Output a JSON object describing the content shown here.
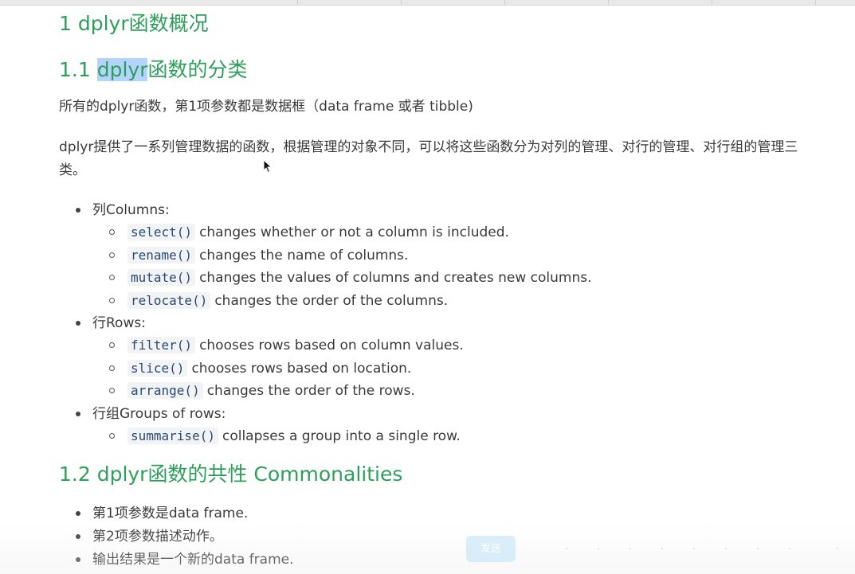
{
  "headings": {
    "h1": "1 dplyr函数概况",
    "h1_1_prefix": "1.1 ",
    "h1_1_highlight": "dplyr",
    "h1_1_suffix": "函数的分类",
    "h1_2": "1.2 dplyr函数的共性 Commonalities"
  },
  "paragraphs": {
    "p1": "所有的dplyr函数，第1项参数都是数据框（data frame 或者 tibble)",
    "p2": "dplyr提供了一系列管理数据的函数，根据管理的对象不同，可以将这些函数分为对列的管理、对行的管理、对行组的管理三类。"
  },
  "categories": [
    {
      "label": "列Columns:",
      "items": [
        {
          "code": "select()",
          "desc": "changes whether or not a column is included."
        },
        {
          "code": "rename()",
          "desc": "changes the name of columns."
        },
        {
          "code": "mutate()",
          "desc": "changes the values of columns and creates new columns."
        },
        {
          "code": "relocate()",
          "desc": "changes the order of the columns."
        }
      ]
    },
    {
      "label": "行Rows:",
      "items": [
        {
          "code": "filter()",
          "desc": "chooses rows based on column values."
        },
        {
          "code": "slice()",
          "desc": "chooses rows based on location."
        },
        {
          "code": "arrange()",
          "desc": "changes the order of the rows."
        }
      ]
    },
    {
      "label": "行组Groups of rows:",
      "items": [
        {
          "code": "summarise()",
          "desc": "collapses a group into a single row."
        }
      ]
    }
  ],
  "commonalities": [
    "第1项参数是data frame.",
    "第2项参数描述动作。",
    "输出结果是一个新的data frame."
  ],
  "overlay": {
    "send_label": "发送"
  },
  "colors": {
    "heading": "#2e9e5b",
    "highlight": "#b3d4fc",
    "code_bg": "#f1f3f5"
  }
}
